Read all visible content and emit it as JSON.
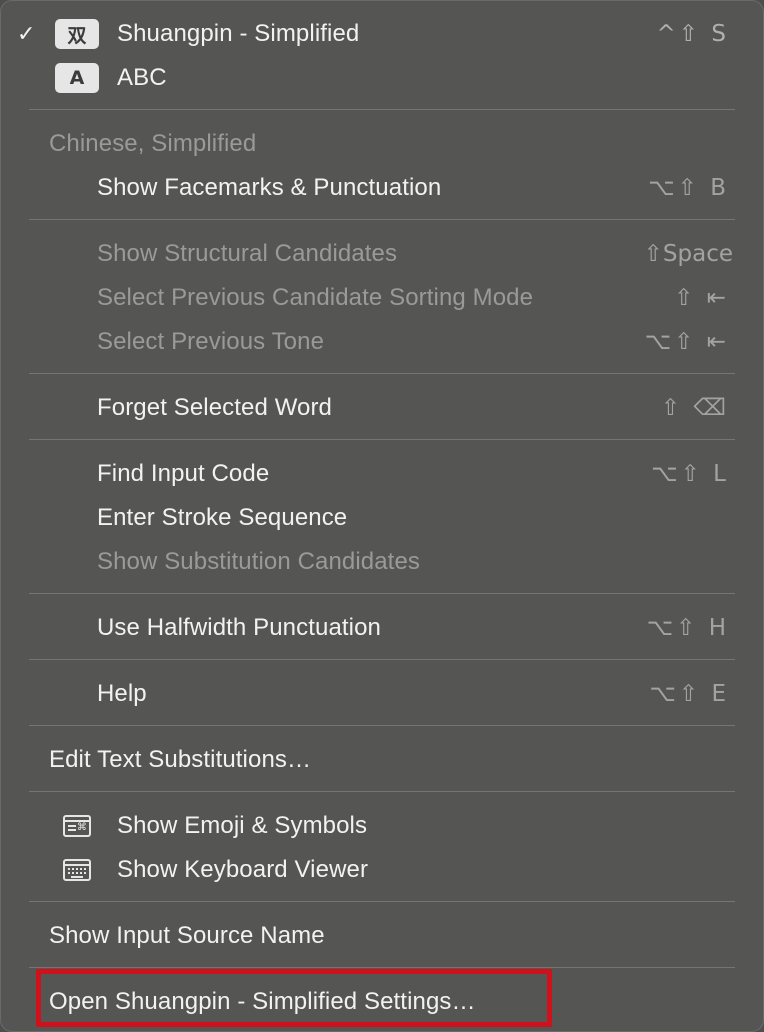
{
  "input_sources": [
    {
      "badge": "双",
      "label": "Shuangpin - Simplified",
      "checked": true,
      "shortcut": "^⇧ S"
    },
    {
      "badge": "A",
      "label": "ABC",
      "checked": false,
      "shortcut": ""
    }
  ],
  "section_header": "Chinese, Simplified",
  "items": {
    "facemarks": {
      "label": "Show Facemarks & Punctuation",
      "shortcut": "⌥⇧ B"
    },
    "structural": {
      "label": "Show Structural Candidates",
      "shortcut": "⇧Space"
    },
    "sorting": {
      "label": "Select Previous Candidate Sorting Mode",
      "shortcut": "⇧ ⇤"
    },
    "tone": {
      "label": "Select Previous Tone",
      "shortcut": "⌥⇧ ⇤"
    },
    "forget": {
      "label": "Forget Selected Word",
      "shortcut": "⇧ ⌫"
    },
    "find_code": {
      "label": "Find Input Code",
      "shortcut": "⌥⇧ L"
    },
    "stroke": {
      "label": "Enter Stroke Sequence",
      "shortcut": ""
    },
    "substitution": {
      "label": "Show Substitution Candidates",
      "shortcut": ""
    },
    "halfwidth": {
      "label": "Use Halfwidth Punctuation",
      "shortcut": "⌥⇧ H"
    },
    "help": {
      "label": "Help",
      "shortcut": "⌥⇧ E"
    },
    "edit_subs": {
      "label": "Edit Text Substitutions…"
    },
    "emoji": {
      "label": "Show Emoji & Symbols"
    },
    "keyboard_viewer": {
      "label": "Show Keyboard Viewer"
    },
    "source_name": {
      "label": "Show Input Source Name"
    },
    "open_settings": {
      "label": "Open Shuangpin - Simplified Settings…"
    }
  },
  "colors": {
    "highlight": "#d0101a",
    "menu_bg": "#555554"
  }
}
